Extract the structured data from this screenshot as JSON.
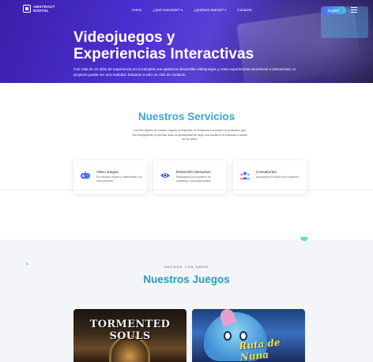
{
  "header": {
    "logo_line1": "ABSTRACT",
    "logo_line2": "DIGITAL",
    "nav": [
      {
        "label": "Home"
      },
      {
        "label": "¿Qué Hacemos?"
      },
      {
        "label": "¿Quiénes Somos?"
      },
      {
        "label": "Contacto"
      }
    ],
    "language_label": "English"
  },
  "hero": {
    "title_line1": "Videojuegos y",
    "title_line2": "Experiencias Interactivas",
    "description": "Con más de 10 años de experiencia en la industria nos apasiona desarrollar videojuegos y crear experiencias inmersivas e interactivas, tu proyecto puede ser una realidad. Estamos a solo un click de contacto."
  },
  "services": {
    "title": "Nuestros Servicios",
    "description": "Los tres pilares de nuestro negocio compiertes, te invitamos a conocer los productos que nos enorgullecen y nos han dado la oportunidad de dejar una huella en la industria a través de los años.",
    "cards": [
      {
        "title": "Video Juegos",
        "text": "De creación propia y colaboración con otros estudios",
        "icon": "gamepad-icon"
      },
      {
        "title": "Desarrollo Interactivo",
        "text": "Realizamos tus proyectos de marketing, comunicacionales",
        "icon": "eye-icon"
      },
      {
        "title": "Consultorías",
        "text": "Apoyamos el camino de tu proyecto",
        "icon": "people-icon"
      }
    ]
  },
  "games": {
    "kicker": "HECHOS CON AMOR",
    "title": "Nuestros Juegos",
    "items": [
      {
        "title": "TORMENTED SOULS"
      },
      {
        "title": "Ruta de Nuna"
      }
    ]
  },
  "colors": {
    "accent_gradient_start": "#4a6cf0",
    "accent_gradient_end": "#43c0e8",
    "hero_base": "#4b2fd0",
    "section_bg": "#f3f5f8"
  }
}
